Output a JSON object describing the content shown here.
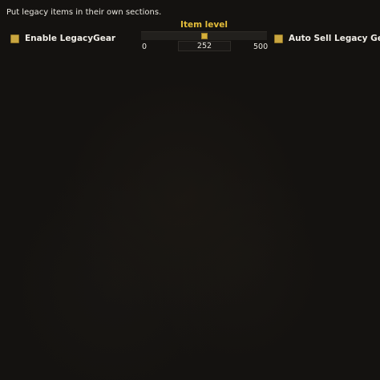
{
  "description": "Put legacy items in their own sections.",
  "checkboxes": {
    "enable_legacy": {
      "label": "Enable LegacyGear",
      "checked": true
    },
    "auto_sell": {
      "label": "Auto Sell Legacy Gear",
      "checked": true
    }
  },
  "slider": {
    "title": "Item level",
    "min": "0",
    "max": "500",
    "value": "252",
    "level": 0.504
  },
  "colors": {
    "accent": "#c9a640",
    "title": "#e4bd3a",
    "background": "#141210"
  }
}
